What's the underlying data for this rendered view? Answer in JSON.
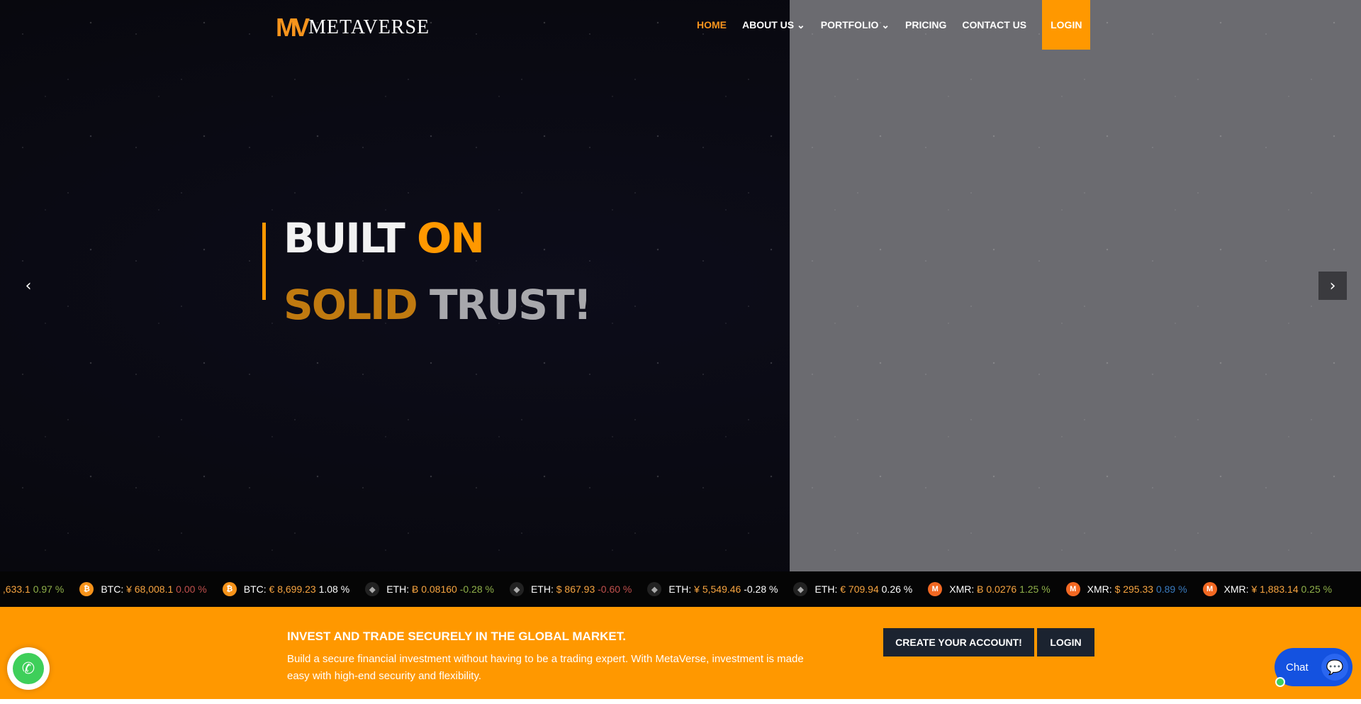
{
  "brand": {
    "logo_mark": "MV",
    "name": "METAVERSE"
  },
  "nav": {
    "items": [
      {
        "label": "HOME"
      },
      {
        "label": "ABOUT US ⌄"
      },
      {
        "label": "PORTFOLIO ⌄"
      },
      {
        "label": "PRICING"
      },
      {
        "label": "CONTACT US"
      }
    ],
    "login": "LOGIN"
  },
  "hero": {
    "line1a": "BUILT",
    "line1b": "ON",
    "line2a": "SOLID",
    "line2b": "TRUST!",
    "prev": "‹",
    "next": "›"
  },
  "ticker": [
    {
      "icon": "btc",
      "sym": "",
      "price": ",633.1",
      "chg": "0.97 %",
      "chg_color": "#8fb04a"
    },
    {
      "icon": "btc",
      "sym": "BTC:",
      "price": "¥ 68,008.1",
      "chg": "0.00 %",
      "chg_color": "#c0504d"
    },
    {
      "icon": "btc",
      "sym": "BTC:",
      "price": "€ 8,699.23",
      "chg": "1.08 %",
      "chg_color": "#ffffff"
    },
    {
      "icon": "eth",
      "sym": "ETH:",
      "price": "Ƀ 0.08160",
      "chg": "-0.28 %",
      "chg_color": "#8fb04a"
    },
    {
      "icon": "eth",
      "sym": "ETH:",
      "price": "$ 867.93",
      "chg": "-0.60 %",
      "chg_color": "#c0504d"
    },
    {
      "icon": "eth",
      "sym": "ETH:",
      "price": "¥ 5,549.46",
      "chg": "-0.28 %",
      "chg_color": "#ffffff"
    },
    {
      "icon": "eth",
      "sym": "ETH:",
      "price": "€ 709.94",
      "chg": "0.26 %",
      "chg_color": "#ffffff"
    },
    {
      "icon": "xmr",
      "sym": "XMR:",
      "price": "Ƀ 0.0276",
      "chg": "1.25 %",
      "chg_color": "#8fb04a"
    },
    {
      "icon": "xmr",
      "sym": "XMR:",
      "price": "$ 295.33",
      "chg": "0.89 %",
      "chg_color": "#3a7bbf"
    },
    {
      "icon": "xmr",
      "sym": "XMR:",
      "price": "¥ 1,883.14",
      "chg": "0.25 %",
      "chg_color": "#8fb04a"
    }
  ],
  "banner": {
    "title": "INVEST AND TRADE SECURELY IN THE GLOBAL MARKET.",
    "text": "Build a secure financial investment without having to be a trading expert. With MetaVerse, investment is made easy with high-end security and flexibility.",
    "create": "CREATE YOUR ACCOUNT!",
    "login": "LOGIN"
  },
  "chat": {
    "label": "Chat"
  },
  "colors": {
    "accent": "#ff9800",
    "dark": "#1b2330",
    "chat": "#1452e0"
  }
}
